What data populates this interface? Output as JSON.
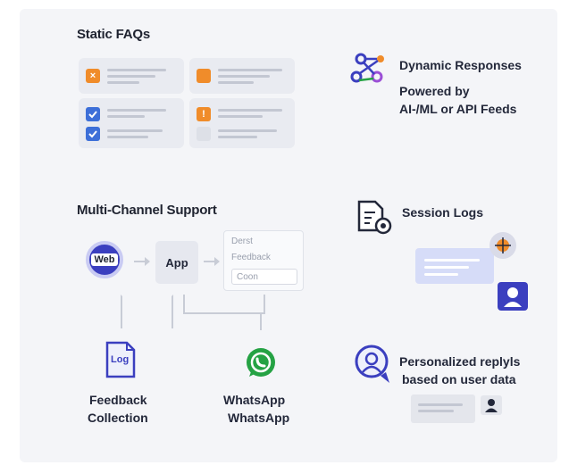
{
  "sections": {
    "static_faqs": {
      "title": "Static FAQs"
    },
    "dynamic": {
      "title": "Dynamic Responses",
      "line1": "Powered by",
      "line2": "AI-/ML or API Feeds"
    },
    "multichannel": {
      "title": "Multi-Channel Support",
      "web_label": "Web",
      "app_label": "App",
      "form_fields": [
        "Derst",
        "Feedback",
        "Coon"
      ]
    },
    "session_logs": {
      "title": "Session Logs"
    },
    "personalized": {
      "line1": "Personalized replyls",
      "line2": "based on user data"
    },
    "feedback": {
      "icon_text": "Log",
      "line1": "Feedback",
      "line2": "Collection"
    },
    "whatsapp": {
      "line1": "WhatsApp",
      "line2": "WhatsApp"
    }
  },
  "colors": {
    "accent_indigo": "#3b3fbf",
    "orange": "#f08c2a",
    "blue_check": "#3d6fd8",
    "whatsapp_green": "#25a244",
    "panel_bg": "#f4f5f8"
  },
  "icons": [
    "close-box-icon",
    "checkbox-icon",
    "warning-icon",
    "network-nodes-icon",
    "document-search-icon",
    "log-file-icon",
    "whatsapp-icon",
    "user-headset-icon",
    "avatar-icon"
  ]
}
